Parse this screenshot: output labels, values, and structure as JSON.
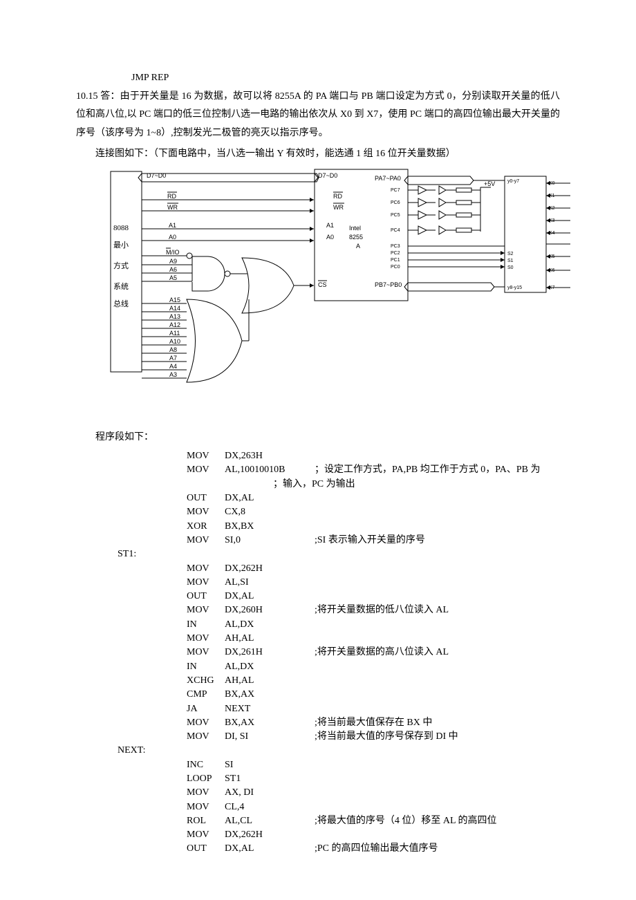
{
  "jmp": "JMP    REP",
  "p1": "10.15 答：由于开关量是 16 为数据，故可以将 8255A 的 PA 端口与 PB 端口设定为方式 0，分别读取开关量的低八位和高八位,以 PC 端口的低三位控制八选一电路的输出依次从 X0 到 X7，使用 PC 端口的高四位输出最大开关量的序号（该序号为 1~8）,控制发光二极管的亮灭以指示序号。",
  "p2": "连接图如下：（下面电路中，当八选一输出 Y 有效时，能选通 1 组 16 位开关量数据）",
  "p3": "程序段如下：",
  "diagram": {
    "left_block_lines": [
      "8088",
      "最小",
      "方式",
      "系统",
      "总线"
    ],
    "d7d0": "D7~D0",
    "rd": "RD",
    "wr": "WR",
    "a1": "A1",
    "a0": "A0",
    "mio": "M/IO",
    "addr_top": [
      "A9",
      "A6",
      "A5"
    ],
    "addr_bot": [
      "A15",
      "A14",
      "A13",
      "A12",
      "A11",
      "A10",
      "A8",
      "A7",
      "A4",
      "A3"
    ],
    "chip": "Intel\n8255\nA",
    "cs": "CS",
    "pa": "PA7~PA0",
    "pb": "PB7~PB0",
    "pc": [
      "PC7",
      "PC6",
      "PC5",
      "PC4",
      "PC3",
      "PC2",
      "PC1",
      "PC0"
    ],
    "v5": "+5V",
    "y_top": "y0-y7",
    "y_bot": "y8-y15",
    "x": [
      "X0",
      "X1",
      "X2",
      "X3",
      "X4",
      "X5",
      "X6",
      "X7"
    ],
    "s": [
      "S2",
      "S1",
      "S0"
    ]
  },
  "code": [
    {
      "label": "",
      "op": "MOV",
      "arg": "DX,263H",
      "cmt": ""
    },
    {
      "label": "",
      "op": "MOV",
      "arg": "AL,10010010B",
      "cmt": "；设定工作方式，PA,PB 均工作于方式 0，PA、PB 为"
    },
    {
      "label": "",
      "op": "",
      "arg": "",
      "cmt": "；输入，PC 为输出"
    },
    {
      "label": "",
      "op": "OUT",
      "arg": "DX,AL",
      "cmt": ""
    },
    {
      "label": "",
      "op": "MOV",
      "arg": " CX,8",
      "cmt": ""
    },
    {
      "label": "",
      "op": "XOR",
      "arg": "BX,BX",
      "cmt": ""
    },
    {
      "label": "",
      "op": "MOV",
      "arg": "SI,0",
      "cmt": ";SI 表示输入开关量的序号"
    },
    {
      "label": "ST1:",
      "op": "",
      "arg": "",
      "cmt": ""
    },
    {
      "label": "",
      "op": "MOV",
      "arg": "DX,262H",
      "cmt": ""
    },
    {
      "label": "",
      "op": "MOV",
      "arg": "AL,SI",
      "cmt": ""
    },
    {
      "label": "",
      "op": "OUT",
      "arg": "DX,AL",
      "cmt": ""
    },
    {
      "label": "",
      "op": "MOV",
      "arg": "DX,260H",
      "cmt": ";将开关量数据的低八位读入 AL"
    },
    {
      "label": "",
      "op": "IN",
      "arg": "  AL,DX",
      "cmt": ""
    },
    {
      "label": "",
      "op": "MOV",
      "arg": "AH,AL",
      "cmt": ""
    },
    {
      "label": "",
      "op": "MOV",
      "arg": "DX,261H",
      "cmt": ";将开关量数据的高八位读入 AL"
    },
    {
      "label": "",
      "op": "IN",
      "arg": "  AL,DX",
      "cmt": ""
    },
    {
      "label": "",
      "op": "XCHG",
      "arg": "AH,AL",
      "cmt": ""
    },
    {
      "label": "",
      "op": "CMP",
      "arg": "BX,AX",
      "cmt": ""
    },
    {
      "label": "",
      "op": "JA",
      "arg": "  NEXT",
      "cmt": ""
    },
    {
      "label": "",
      "op": "MOV",
      "arg": "BX,AX",
      "cmt": ";将当前最大值保存在 BX 中"
    },
    {
      "label": "",
      "op": "MOV",
      "arg": "DI, SI",
      "cmt": ";将当前最大值的序号保存到 DI 中"
    },
    {
      "label": "NEXT:",
      "op": "",
      "arg": "",
      "cmt": ""
    },
    {
      "label": "",
      "op": "INC",
      "arg": "  SI",
      "cmt": ""
    },
    {
      "label": "",
      "op": "LOOP",
      "arg": "ST1",
      "cmt": ""
    },
    {
      "label": "",
      "op": "MOV",
      "arg": " AX, DI",
      "cmt": ""
    },
    {
      "label": "",
      "op": "MOV",
      "arg": " CL,4",
      "cmt": ""
    },
    {
      "label": "",
      "op": "ROL",
      "arg": "  AL,CL",
      "cmt": ";将最大值的序号（4 位）移至 AL 的高四位"
    },
    {
      "label": "",
      "op": "MOV",
      "arg": "  DX,262H",
      "cmt": ""
    },
    {
      "label": "",
      "op": "OUT",
      "arg": " DX,AL",
      "cmt": ";PC 的高四位输出最大值序号"
    }
  ]
}
